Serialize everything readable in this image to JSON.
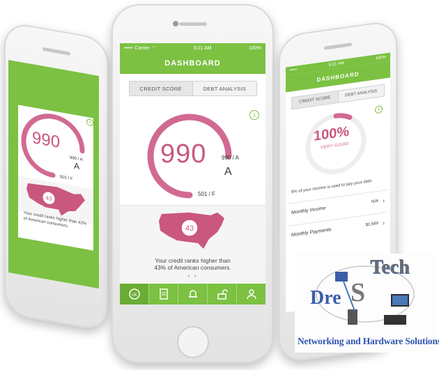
{
  "colors": {
    "accent_green": "#7cc142",
    "score_pink": "#c9577f"
  },
  "center_phone": {
    "status_bar": {
      "carrier": "Carrier",
      "time": "9:21 AM",
      "battery": "100%"
    },
    "header_title": "DASHBOARD",
    "tabs": [
      {
        "label": "CREDIT SCORE",
        "active": true
      },
      {
        "label": "DEBT ANALYSIS",
        "active": false
      }
    ],
    "score": {
      "value": "990",
      "max_label": "990 / A",
      "grade": "A",
      "min_label": "501 / F",
      "gauge_fraction": 0.95
    },
    "map": {
      "percent_badge": "43",
      "caption_line1": "Your credit ranks higher than",
      "caption_line2": "43% of American consumers."
    },
    "nav_icons": [
      "credit-karma-icon",
      "document-icon",
      "bell-icon",
      "unlock-icon",
      "profile-icon"
    ]
  },
  "left_phone": {
    "score": {
      "value": "990",
      "max_label": "990 / A",
      "grade": "A",
      "min_label": "501 / F"
    },
    "map": {
      "percent_badge": "43",
      "caption": "Your credit ranks higher than 43% of American consumers."
    }
  },
  "right_phone": {
    "status_bar": {
      "time": "9:21 AM",
      "battery": "100%"
    },
    "header_title": "DASHBOARD",
    "tabs": [
      {
        "label": "CREDIT SCORE",
        "active": true
      },
      {
        "label": "DEBT ANALYSIS",
        "active": false
      }
    ],
    "ratio": {
      "value": "100%",
      "label": "VERY GOOD",
      "gauge_fraction": 0.08
    },
    "note": "9% of your income is used to pay your debt.",
    "rows": [
      {
        "label": "Monthly Income",
        "value": "N/A"
      },
      {
        "label": "Monthly Payments",
        "value": "$1,560"
      }
    ]
  },
  "logo": {
    "tech": "Tech",
    "dre": "Dre",
    "s": "S",
    "tagline": "Networking and Hardware Solutions"
  }
}
